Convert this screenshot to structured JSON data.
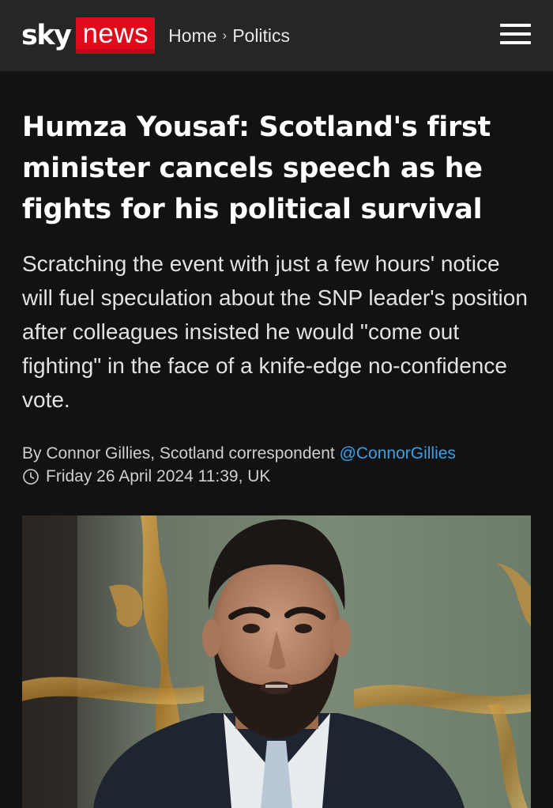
{
  "header": {
    "logo_sky": "sky",
    "logo_news": "news",
    "breadcrumb": [
      "Home",
      "Politics"
    ],
    "breadcrumb_separator": "›",
    "menu_icon": "hamburger-menu-icon"
  },
  "article": {
    "headline_lines": [
      "Humza Yousaf: Scotland's first",
      "minister cancels speech as he",
      "fights for his political survival"
    ],
    "standfirst": "Scratching the event with just a few hours' notice will fuel speculation about the SNP leader's position after colleagues insisted he would \"come out fighting\" in the face of a knife-edge no-confidence vote.",
    "byline_prefix": "By Connor Gillies, Scotland correspondent",
    "byline_handle": "@ConnorGillies",
    "date": "Friday 26 April 2024 11:39, UK",
    "date_icon": "clock-icon"
  },
  "colors": {
    "brand_red": "#e10a1b",
    "link_blue": "#3aa0e8",
    "background": "#121212",
    "topbar": "#262626"
  }
}
